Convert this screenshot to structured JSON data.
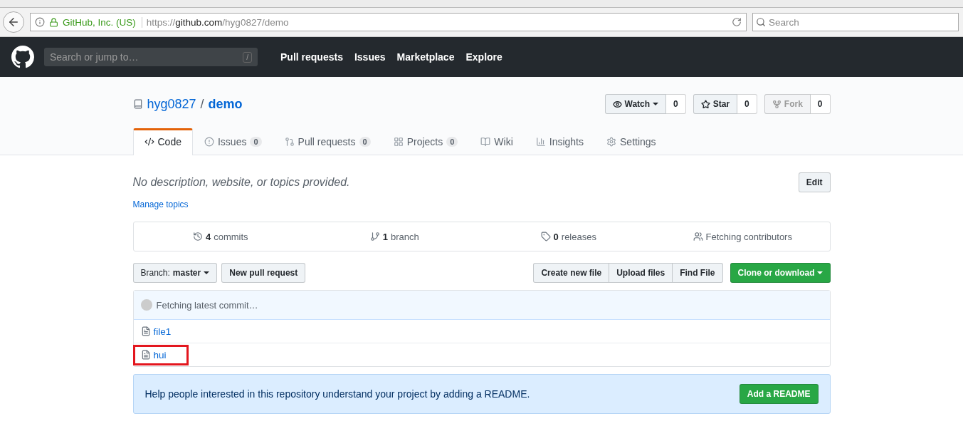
{
  "browser": {
    "site_identity": "GitHub, Inc. (US)",
    "url_prefix": "https://",
    "url_host": "github.com",
    "url_path": "/hyg0827/demo",
    "search_placeholder": "Search"
  },
  "header": {
    "search_placeholder": "Search or jump to…",
    "search_key": "/",
    "nav": [
      "Pull requests",
      "Issues",
      "Marketplace",
      "Explore"
    ]
  },
  "repo": {
    "owner": "hyg0827",
    "separator": "/",
    "name": "demo",
    "actions": [
      {
        "kind": "watch",
        "label": "Watch",
        "count": "0",
        "disabled": false
      },
      {
        "kind": "star",
        "label": "Star",
        "count": "0",
        "disabled": false
      },
      {
        "kind": "fork",
        "label": "Fork",
        "count": "0",
        "disabled": true
      }
    ]
  },
  "tabs": [
    {
      "kind": "code",
      "label": "Code",
      "selected": true
    },
    {
      "kind": "issues",
      "label": "Issues",
      "count": "0",
      "selected": false
    },
    {
      "kind": "pulls",
      "label": "Pull requests",
      "count": "0",
      "selected": false
    },
    {
      "kind": "projects",
      "label": "Projects",
      "count": "0",
      "selected": false
    },
    {
      "kind": "wiki",
      "label": "Wiki",
      "selected": false
    },
    {
      "kind": "insights",
      "label": "Insights",
      "selected": false
    },
    {
      "kind": "settings",
      "label": "Settings",
      "selected": false
    }
  ],
  "description": "No description, website, or topics provided.",
  "edit_button": "Edit",
  "manage_topics": "Manage topics",
  "summary": [
    {
      "kind": "commits",
      "count": "4",
      "label": "commits"
    },
    {
      "kind": "branch",
      "count": "1",
      "label": "branch"
    },
    {
      "kind": "releases",
      "count": "0",
      "label": "releases"
    },
    {
      "kind": "contributors",
      "label": "Fetching contributors"
    }
  ],
  "branch": {
    "label": "Branch:",
    "value": "master"
  },
  "new_pull_request": "New pull request",
  "file_buttons": [
    "Create new file",
    "Upload files",
    "Find File"
  ],
  "clone_button": "Clone or download",
  "commit_status": "Fetching latest commit…",
  "files": [
    {
      "name": "file1",
      "highlighted": false
    },
    {
      "name": "hui",
      "highlighted": true
    }
  ],
  "readme_prompt": {
    "text": "Help people interested in this repository understand your project by adding a README.",
    "button": "Add a README"
  }
}
